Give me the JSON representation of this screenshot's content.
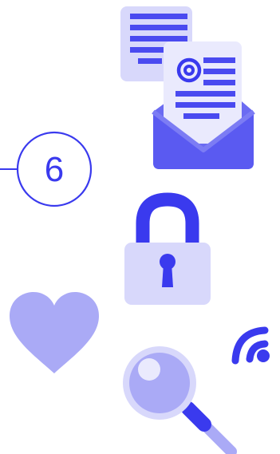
{
  "step": {
    "number": "6"
  },
  "icons": {
    "email": "email-with-documents-icon",
    "email_symbol": "@",
    "lock": "padlock-icon",
    "heart": "heart-icon",
    "search": "magnifying-glass-icon",
    "wifi": "wifi-signal-icon"
  },
  "colors": {
    "primary": "#3a3aee",
    "light": "#aaaaf6",
    "lighter": "#d8d8fb",
    "lightest": "#e9e9fd",
    "white": "#ffffff"
  }
}
